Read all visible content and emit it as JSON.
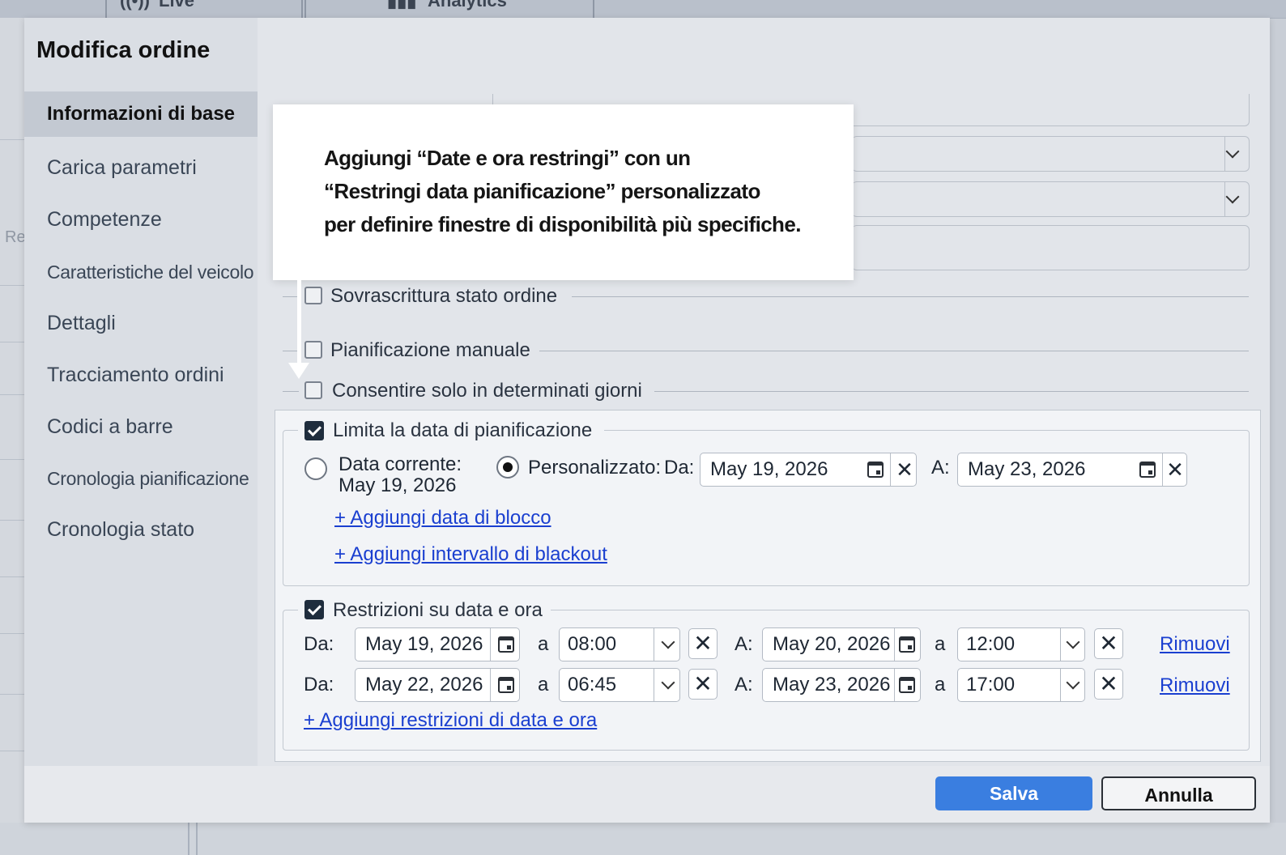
{
  "background": {
    "tabs": [
      {
        "icon": "live-icon",
        "label": "Live"
      },
      {
        "icon": "analytics-icon",
        "label": "Analytics"
      }
    ],
    "left_fragment": "Re"
  },
  "dialog": {
    "title": "Modifica ordine",
    "nav": [
      {
        "label": "Informazioni di base",
        "active": true
      },
      {
        "label": "Carica parametri"
      },
      {
        "label": "Competenze"
      },
      {
        "label": "Caratteristiche del veicolo"
      },
      {
        "label": "Dettagli"
      },
      {
        "label": "Tracciamento ordini"
      },
      {
        "label": "Codici a barre"
      },
      {
        "label": "Cronologia pianificazione"
      },
      {
        "label": "Cronologia stato"
      }
    ],
    "checkboxes": {
      "override": {
        "label": "Sovrascrittura stato ordine",
        "checked": false
      },
      "manual": {
        "label": "Pianificazione manuale",
        "checked": false
      },
      "days": {
        "label": "Consentire solo in determinati giorni",
        "checked": false
      }
    },
    "limit": {
      "label": "Limita la data di pianificazione",
      "checked": true,
      "current_label": "Data corrente:",
      "current_date": "May 19, 2026",
      "custom_label": "Personalizzato:",
      "from_label": "Da:",
      "from_date": "May 19, 2026",
      "to_label": "A:",
      "to_date": "May 23, 2026",
      "add_block": "+ Aggiungi data di blocco",
      "add_blackout": "+ Aggiungi intervallo di blackout"
    },
    "restrictions": {
      "label": "Restrizioni su data e ora",
      "checked": true,
      "from_label": "Da:",
      "at_label": "a",
      "to_label": "A:",
      "rows": [
        {
          "from_date": "May 19, 2026",
          "from_time": "08:00",
          "to_date": "May 20, 2026",
          "to_time": "12:00",
          "remove": "Rimuovi"
        },
        {
          "from_date": "May 22, 2026",
          "from_time": "06:45",
          "to_date": "May 23, 2026",
          "to_time": "17:00",
          "remove": "Rimuovi"
        }
      ],
      "add": "+ Aggiungi restrizioni di data e ora"
    },
    "footer": {
      "save": "Salva",
      "cancel": "Annulla"
    }
  },
  "callout": {
    "line1": "Aggiungi “Date e ora restringi” con un",
    "line2": "“Restringi data pianificazione” personalizzato",
    "line3": "per definire finestre di disponibilità più specifiche."
  },
  "colors": {
    "accent": "#3a7ee0",
    "link": "#1a3fd0"
  }
}
